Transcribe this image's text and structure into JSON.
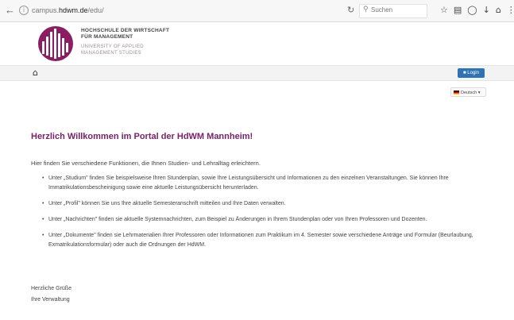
{
  "browser": {
    "back_icon": "arrow-left-icon",
    "url_prefix": "campus.",
    "url_domain": "hdwm.de",
    "url_suffix": "/edu/",
    "search_placeholder": "Suchen",
    "toolbar_icons": [
      "star-icon",
      "library-icon",
      "pocket-icon",
      "download-icon",
      "home-icon"
    ]
  },
  "header": {
    "school_name_line1": "HOCHSCHULE DER WIRTSCHAFT",
    "school_name_line2": "FÜR MANAGEMENT",
    "school_sub_line1": "UNIVERSITY OF APPLIED",
    "school_sub_line2": "MANAGEMENT STUDIES",
    "brand_color": "#8b1d62"
  },
  "nav": {
    "home_icon": "home-icon",
    "login_label": "Login",
    "login_color": "#2f73b4",
    "language_label": "Deutsch"
  },
  "main": {
    "title": "Herzlich Willkommen im Portal der HdWM Mannheim!",
    "intro": "Hier finden Sie verschiedene Funktionen, die Ihnen Studien- und Lehralltag erleichtern.",
    "items": [
      "Unter „Studium\" finden Sie beispielsweise Ihren Stundenplan, sowie Ihre Leistungsübersicht und Informationen zu den einzelnen Veranstaltungen. Sie können Ihre Immatrikulationsbescheinigung sowie eine aktuelle Leistungsübersicht herunterladen.",
      "Unter „Profil\" können Sie uns Ihre aktuelle Semesteranschrift mitteilen und Ihre Daten verwalten.",
      "Unter „Nachrichten\" finden sie aktuelle Systemnachrichten, zum Beispiel zu Änderungen in Ihrem Stundenplan oder von Ihren Professoren und Dozenten.",
      "Unter „Dokumente\" finden sie Lehrmaterialien Ihrer Professoren oder Informationen zum Praktikum im 4. Semester sowie verschiedene Anträge und Formular (Beurlaubung, Exmatrikulationsformular) oder auch die Ordnungen der HdWM."
    ],
    "greeting_line1": "Herzliche Grüße",
    "greeting_line2": "Ihre Verwaltung"
  }
}
